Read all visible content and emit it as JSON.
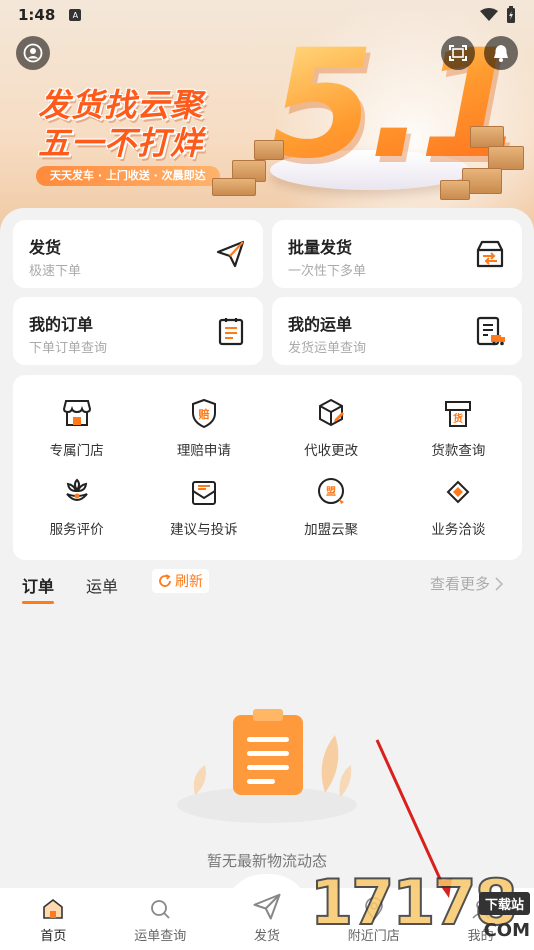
{
  "status": {
    "time": "1:48",
    "badge": "A"
  },
  "banner": {
    "title_line1": "发货找云聚",
    "title_line2": "五一不打烊",
    "slogan": "天天发车 · 上门收送 · 次晨即达",
    "big_number": "5.1"
  },
  "quick_cards": [
    {
      "title": "发货",
      "subtitle": "极速下单",
      "icon": "paper-plane-icon"
    },
    {
      "title": "批量发货",
      "subtitle": "一次性下多单",
      "icon": "box-transfer-icon"
    },
    {
      "title": "我的订单",
      "subtitle": "下单订单查询",
      "icon": "clipboard-icon"
    },
    {
      "title": "我的运单",
      "subtitle": "发货运单查询",
      "icon": "waybill-truck-icon"
    }
  ],
  "services": [
    {
      "label": "专属门店",
      "icon": "store-icon"
    },
    {
      "label": "理赔申请",
      "icon": "claim-shield-icon"
    },
    {
      "label": "代收更改",
      "icon": "package-edit-icon"
    },
    {
      "label": "货款查询",
      "icon": "payment-icon"
    },
    {
      "label": "服务评价",
      "icon": "flower-rating-icon"
    },
    {
      "label": "建议与投诉",
      "icon": "mail-icon"
    },
    {
      "label": "加盟云聚",
      "icon": "join-badge-icon"
    },
    {
      "label": "业务洽谈",
      "icon": "handshake-icon"
    }
  ],
  "tabs": {
    "order": "订单",
    "waybill": "运单",
    "refresh": "刷新",
    "see_more": "查看更多"
  },
  "empty": {
    "text": "暂无最新物流动态"
  },
  "nav": [
    {
      "label": "首页",
      "icon": "home-icon"
    },
    {
      "label": "运单查询",
      "icon": "search-icon"
    },
    {
      "label": "发货",
      "icon": "send-icon"
    },
    {
      "label": "附近门店",
      "icon": "location-icon"
    },
    {
      "label": "我的",
      "icon": "profile-icon"
    }
  ],
  "watermark": {
    "digits": "17178",
    "tag": "下载站",
    "suffix": "COM"
  },
  "colors": {
    "accent": "#ff7a1a",
    "brand_orange": "#ff5a1a"
  }
}
